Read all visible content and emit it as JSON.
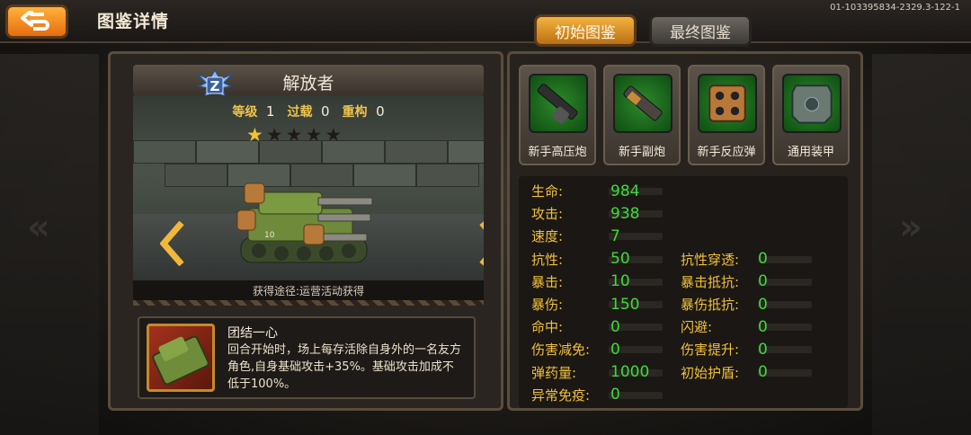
{
  "header": {
    "title": "图鉴详情",
    "build_id": "01-103395834-2329.3-122-1"
  },
  "tabs": [
    {
      "label": "初始图鉴",
      "active": true
    },
    {
      "label": "最终图鉴",
      "active": false
    }
  ],
  "unit": {
    "name": "解放者",
    "rank_badge": "Z",
    "level_label": "等级",
    "level": "1",
    "overload_label": "过载",
    "overload": "0",
    "rebuild_label": "重构",
    "rebuild": "0",
    "stars_filled": 1,
    "stars_total": 5,
    "source": "获得途径:运营活动获得",
    "tank_number": "10"
  },
  "skill": {
    "name": "团结一心",
    "description": "回合开始时，场上每存活除自身外的一名友方角色,自身基础攻击+35%。基础攻击加成不低于100%。"
  },
  "equipment": [
    {
      "label": "新手高压炮",
      "icon": "cannon-icon"
    },
    {
      "label": "新手副炮",
      "icon": "secondary-gun-icon"
    },
    {
      "label": "新手反应弹",
      "icon": "missile-pod-icon"
    },
    {
      "label": "通用装甲",
      "icon": "armor-plate-icon"
    }
  ],
  "attributes": {
    "left": [
      {
        "key": "生命:",
        "value": "984"
      },
      {
        "key": "攻击:",
        "value": "938"
      },
      {
        "key": "速度:",
        "value": "7"
      },
      {
        "key": "抗性:",
        "value": "50"
      },
      {
        "key": "暴击:",
        "value": "10"
      },
      {
        "key": "暴伤:",
        "value": "150"
      },
      {
        "key": "命中:",
        "value": "0"
      },
      {
        "key": "伤害减免:",
        "value": "0"
      },
      {
        "key": "弹药量:",
        "value": "1000"
      },
      {
        "key": "异常免疫:",
        "value": "0"
      }
    ],
    "right": [
      {
        "key": "抗性穿透:",
        "value": "0"
      },
      {
        "key": "暴击抵抗:",
        "value": "0"
      },
      {
        "key": "暴伤抵抗:",
        "value": "0"
      },
      {
        "key": "闪避:",
        "value": "0"
      },
      {
        "key": "伤害提升:",
        "value": "0"
      },
      {
        "key": "初始护盾:",
        "value": "0"
      }
    ]
  },
  "colors": {
    "accent_orange": "#e8901f",
    "stat_key": "#f2c13a",
    "stat_value": "#3ddb3a"
  }
}
